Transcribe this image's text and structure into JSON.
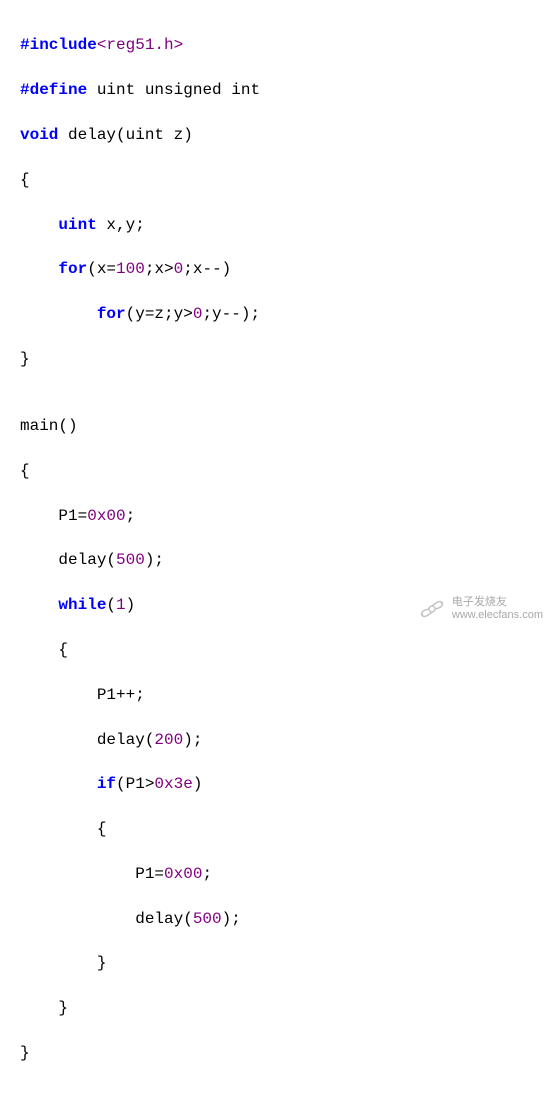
{
  "code": {
    "l1_pp": "#include",
    "l1_hdr": "<reg51.h>",
    "l2_pp": "#define",
    "l2_rest": " uint unsigned int",
    "l3_void": "void",
    "l3_fn": " delay(uint z)",
    "l4": "{",
    "l5_kw": "uint",
    "l5_rest": " x,y;",
    "l6_for": "for",
    "l6_a": "(x=",
    "l6_n1": "100",
    "l6_b": ";x>",
    "l6_n2": "0",
    "l6_c": ";x--)",
    "l7_for": "for",
    "l7_a": "(y=z;y>",
    "l7_n": "0",
    "l7_b": ";y--);",
    "l8": "}",
    "l9": "",
    "l10": "main()",
    "l11": "{",
    "l12_a": "P1=",
    "l12_n": "0x00",
    "l12_b": ";",
    "l13_a": "delay(",
    "l13_n": "500",
    "l13_b": ");",
    "l14_kw": "while",
    "l14_a": "(",
    "l14_n": "1",
    "l14_b": ")",
    "l15": "{",
    "l16": "P1++;",
    "l17_a": "delay(",
    "l17_n": "200",
    "l17_b": ");",
    "l18_kw": "if",
    "l18_a": "(P1>",
    "l18_n": "0x3e",
    "l18_b": ")",
    "l19": "{",
    "l20_a": "P1=",
    "l20_n": "0x00",
    "l20_b": ";",
    "l21_a": "delay(",
    "l21_n": "500",
    "l21_b": ");",
    "l22": "}",
    "l23": "}",
    "l24": "}"
  },
  "watermark": {
    "line1": "电子发烧友",
    "line2": "www.elecfans.com"
  }
}
